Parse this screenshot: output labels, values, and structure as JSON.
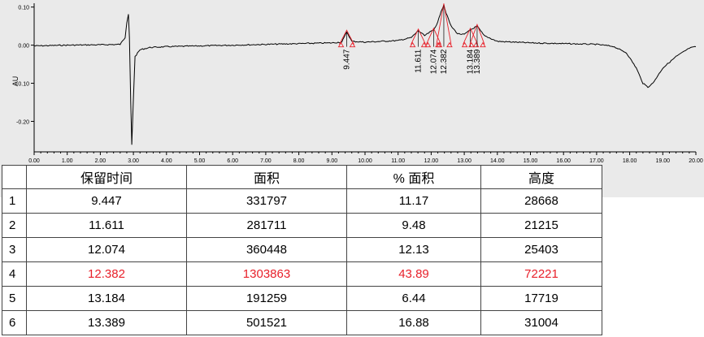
{
  "colors": {
    "trace": "#000000",
    "marker": "#e8202a",
    "highlight": "#e8202a",
    "panel": "#eaeaea"
  },
  "chart_data": {
    "type": "line",
    "xlim": [
      0.0,
      20.0
    ],
    "ylim": [
      -0.28,
      0.11
    ],
    "ylabel": "AU",
    "xticks": [
      "0.00",
      "1.00",
      "2.00",
      "3.00",
      "4.00",
      "5.00",
      "6.00",
      "7.00",
      "8.00",
      "9.00",
      "10.00",
      "11.00",
      "12.00",
      "13.00",
      "14.00",
      "15.00",
      "16.00",
      "17.00",
      "18.00",
      "19.00",
      "20.00"
    ],
    "yticks": [
      "0.10",
      "0.00",
      "-0.10",
      "-0.20"
    ],
    "baseline": [
      [
        0,
        -0.002
      ],
      [
        1,
        0.0
      ],
      [
        2,
        0.001
      ],
      [
        2.6,
        0.002
      ],
      [
        2.75,
        0.02
      ],
      [
        2.8,
        0.06
      ],
      [
        2.85,
        0.082
      ],
      [
        2.88,
        0.02
      ],
      [
        2.92,
        -0.15
      ],
      [
        2.95,
        -0.262
      ],
      [
        3.0,
        -0.14
      ],
      [
        3.05,
        -0.03
      ],
      [
        3.2,
        -0.012
      ],
      [
        3.5,
        -0.006
      ],
      [
        4,
        -0.004
      ],
      [
        5,
        -0.002
      ],
      [
        6,
        0.0
      ],
      [
        7,
        0.002
      ],
      [
        8,
        0.004
      ],
      [
        9,
        0.006
      ],
      [
        9.3,
        0.008
      ],
      [
        9.45,
        0.035
      ],
      [
        9.6,
        0.01
      ],
      [
        10,
        0.008
      ],
      [
        11,
        0.012
      ],
      [
        11.4,
        0.02
      ],
      [
        11.61,
        0.038
      ],
      [
        11.8,
        0.025
      ],
      [
        12.07,
        0.04
      ],
      [
        12.2,
        0.06
      ],
      [
        12.3,
        0.09
      ],
      [
        12.382,
        0.105
      ],
      [
        12.45,
        0.085
      ],
      [
        12.6,
        0.05
      ],
      [
        12.8,
        0.03
      ],
      [
        13.0,
        0.028
      ],
      [
        13.184,
        0.04
      ],
      [
        13.389,
        0.05
      ],
      [
        13.6,
        0.025
      ],
      [
        14,
        0.01
      ],
      [
        15,
        0.006
      ],
      [
        16,
        0.004
      ],
      [
        17,
        0.002
      ],
      [
        17.5,
        -0.003
      ],
      [
        17.9,
        -0.02
      ],
      [
        18.2,
        -0.06
      ],
      [
        18.4,
        -0.1
      ],
      [
        18.55,
        -0.11
      ],
      [
        18.7,
        -0.1
      ],
      [
        19.0,
        -0.06
      ],
      [
        19.4,
        -0.03
      ],
      [
        19.8,
        -0.008
      ],
      [
        20,
        -0.004
      ]
    ],
    "peak_labels": [
      "9.447",
      "11.611",
      "12.074",
      "12.382",
      "13.184",
      "13.389"
    ],
    "peaks": [
      9.447,
      11.611,
      12.074,
      12.382,
      13.184,
      13.389
    ],
    "peak_heights": [
      0.035,
      0.038,
      0.04,
      0.105,
      0.04,
      0.05
    ]
  },
  "table": {
    "headers": [
      "保留时间",
      "面积",
      "% 面积",
      "高度"
    ],
    "rows": [
      {
        "idx": "1",
        "rt": "9.447",
        "area": "331797",
        "pct": "11.17",
        "height": "28668"
      },
      {
        "idx": "2",
        "rt": "11.611",
        "area": "281711",
        "pct": "9.48",
        "height": "21215"
      },
      {
        "idx": "3",
        "rt": "12.074",
        "area": "360448",
        "pct": "12.13",
        "height": "25403"
      },
      {
        "idx": "4",
        "rt": "12.382",
        "area": "1303863",
        "pct": "43.89",
        "height": "72221"
      },
      {
        "idx": "5",
        "rt": "13.184",
        "area": "191259",
        "pct": "6.44",
        "height": "17719"
      },
      {
        "idx": "6",
        "rt": "13.389",
        "area": "501521",
        "pct": "16.88",
        "height": "31004"
      }
    ],
    "highlight_row": 3
  }
}
